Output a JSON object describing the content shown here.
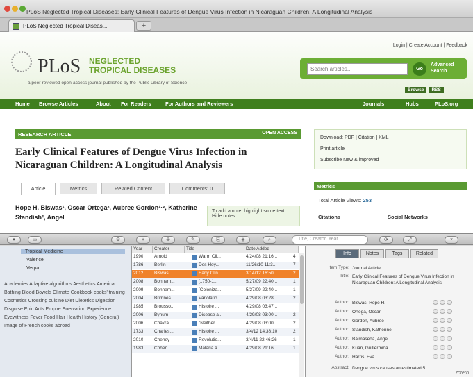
{
  "window": {
    "title": "PLoS Neglected Tropical Diseases: Early Clinical Features of Dengue Virus Infection in Nicaraguan Children: A Longitudinal Analysis"
  },
  "browser": {
    "tab_label": "PLoS Neglected Tropical Diseas...",
    "new_tab": "+"
  },
  "site": {
    "logo_plos": "PLoS",
    "logo_ntd": "NEGLECTED TROPICAL DISEASES",
    "tagline": "a peer-reviewed open-access journal published by the Public Library of Science",
    "top_links": "Login | Create Account | Feedback",
    "search_placeholder": "Search articles...",
    "go": "Go",
    "advanced_search": "Advanced Search",
    "browse": "Browse",
    "rss": "RSS",
    "nav": [
      "Home",
      "Browse Articles",
      "About",
      "For Readers",
      "For Authors and Reviewers",
      "Journals",
      "Hubs",
      "PLoS.org"
    ]
  },
  "article": {
    "badge": "RESEARCH ARTICLE",
    "open_access": "OPEN ACCESS",
    "title": "Early Clinical Features of Dengue Virus Infection in Nicaraguan Children: A Longitudinal Analysis",
    "tabs": [
      "Article",
      "Metrics",
      "Related Content",
      "Comments: 0"
    ],
    "authors": "Hope H. Biswas¹, Oscar Ortega², Aubree Gordon¹·², Katherine Standish², Angel",
    "note": "To add a note, highlight some text. Hide notes"
  },
  "sidebar": {
    "download": "Download: PDF | Citation | XML",
    "print": "Print article",
    "subscribe": "Subscribe New & improved",
    "metrics_header": "Metrics",
    "total_views_label": "Total Article Views:",
    "total_views": "253",
    "citations": "Citations",
    "social": "Social Networks"
  },
  "zotero": {
    "search_placeholder": "Title, Creator, Year",
    "collections": [
      "Tropical Medicine",
      "Valence",
      "Verpa"
    ],
    "tags": "Academies Adaptive algorithms Aesthetics America Bathing Blood Bowels Climate Cookbook cooks' training Cosmetics Crossing cuisine Diet Dietetics Digestion Disguise Epic Acts Empire Enervation Experience Eyewitness Fever Food Hair Health History (General) Image of French cooks abroad",
    "columns": [
      "Year",
      "Creator",
      "Title",
      "Date Added"
    ],
    "rows": [
      {
        "year": "1990",
        "creator": "Arnold",
        "title": "Warm Cli...",
        "date": "4/24/08 21:16...",
        "n": "4"
      },
      {
        "year": "1786",
        "creator": "Berlin",
        "title": "Des Hoy...",
        "date": "11/26/10 11:3...",
        "n": "7"
      },
      {
        "year": "2012",
        "creator": "Biswas",
        "title": "Early Clin...",
        "date": "3/14/12 16:50...",
        "n": "2"
      },
      {
        "year": "2008",
        "creator": "Bonnem...",
        "title": "[1750-1...",
        "date": "5/27/09 22:40...",
        "n": "1"
      },
      {
        "year": "2009",
        "creator": "Bonnem...",
        "title": "[Coloniza...",
        "date": "5/27/09 22:40...",
        "n": "1"
      },
      {
        "year": "2004",
        "creator": "Brimnes",
        "title": "Variolatio...",
        "date": "4/29/08 03:28...",
        "n": "2"
      },
      {
        "year": "1985",
        "creator": "Brousso...",
        "title": "Histoire ...",
        "date": "4/29/08 03:47...",
        "n": ""
      },
      {
        "year": "2006",
        "creator": "Bynum",
        "title": "Disease a...",
        "date": "4/29/08 03:00...",
        "n": "2"
      },
      {
        "year": "2006",
        "creator": "Chakra...",
        "title": "\"Neither ...",
        "date": "4/29/08 03:00...",
        "n": "2"
      },
      {
        "year": "1733",
        "creator": "Charles...",
        "title": "Histoire ...",
        "date": "3/4/12 14:38:10",
        "n": "2"
      },
      {
        "year": "2010",
        "creator": "Cheney",
        "title": "Revolutio...",
        "date": "3/4/11 22:46:26",
        "n": "1"
      },
      {
        "year": "1983",
        "creator": "Cohen",
        "title": "Malaria a...",
        "date": "4/29/08 21:16...",
        "n": "1"
      }
    ],
    "pane_tabs": [
      "Info",
      "Notes",
      "Tags",
      "Related"
    ],
    "item_type_label": "Item Type:",
    "item_type": "Journal Article",
    "title_label": "Title:",
    "item_title": "Early Clinical Features of Dengue Virus Infection in Nicaraguan Children: A Longitudinal Analysis",
    "author_label": "Author:",
    "authors": [
      "Biswas, Hope H.",
      "Ortega, Oscar",
      "Gordon, Aubree",
      "Standish, Katherine",
      "Balmaseda, Angel",
      "Kuan, Guillermina",
      "Harris, Eva"
    ],
    "abstract_label": "Abstract:",
    "abstract": "Dengue virus causes an estimated 5...",
    "brand": "zotero"
  },
  "colors": {
    "plos_green": "#5a9a32",
    "nav_green": "#3f7f1d",
    "selection_orange": "#f0822a"
  }
}
